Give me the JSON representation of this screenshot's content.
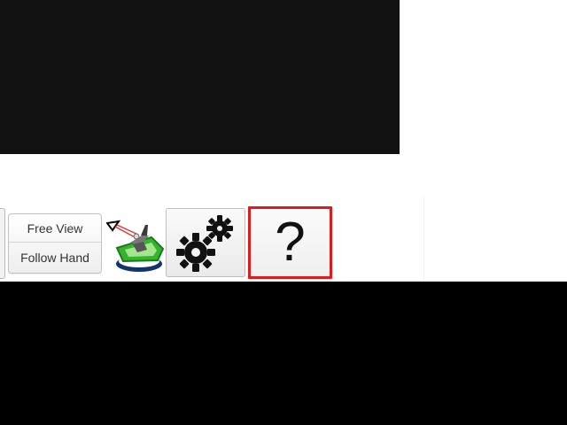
{
  "toolbar": {
    "view_modes": {
      "free_view_label": "Free View",
      "follow_hand_label": "Follow Hand"
    },
    "help_label": "?"
  },
  "icons": {
    "device": "haptic-device-icon",
    "settings": "gear-icon",
    "help": "help-icon"
  },
  "colors": {
    "viewport": "#121212",
    "selection_outline": "#e01b1b",
    "device_green": "#35b52d",
    "device_blue": "#12346c"
  }
}
